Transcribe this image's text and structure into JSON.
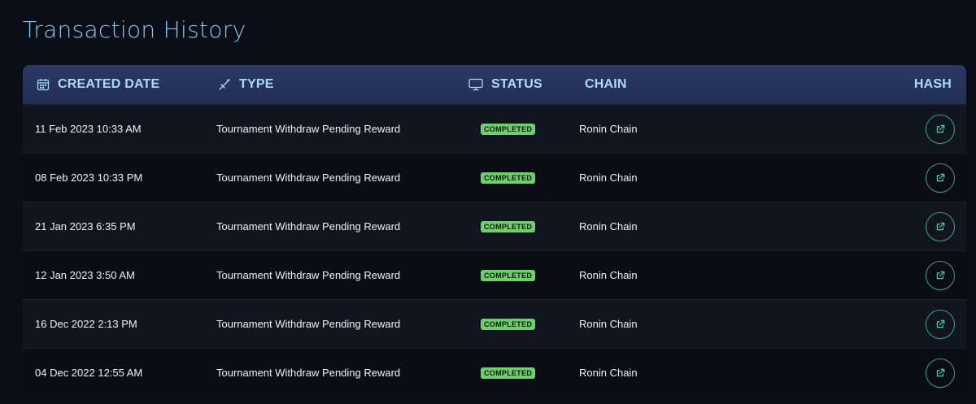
{
  "title": "Transaction History",
  "columns": {
    "date": "CREATED DATE",
    "type": "TYPE",
    "status": "STATUS",
    "chain": "CHAIN",
    "hash": "HASH"
  },
  "icons": {
    "date": "calendar-icon",
    "type": "sword-icon",
    "status": "monitor-icon",
    "hash": "external-link-icon"
  },
  "colors": {
    "title": "#7fc8ec",
    "header_text": "#a9dbf6",
    "header_bg": "#26335e",
    "badge_bg": "#6fcf6c",
    "link_border": "#3c9f8f"
  },
  "rows": [
    {
      "date": "11 Feb 2023 10:33 AM",
      "type": "Tournament Withdraw Pending Reward",
      "status": "COMPLETED",
      "chain": "Ronin Chain"
    },
    {
      "date": "08 Feb 2023 10:33 PM",
      "type": "Tournament Withdraw Pending Reward",
      "status": "COMPLETED",
      "chain": "Ronin Chain"
    },
    {
      "date": "21 Jan 2023 6:35 PM",
      "type": "Tournament Withdraw Pending Reward",
      "status": "COMPLETED",
      "chain": "Ronin Chain"
    },
    {
      "date": "12 Jan 2023 3:50 AM",
      "type": "Tournament Withdraw Pending Reward",
      "status": "COMPLETED",
      "chain": "Ronin Chain"
    },
    {
      "date": "16 Dec 2022 2:13 PM",
      "type": "Tournament Withdraw Pending Reward",
      "status": "COMPLETED",
      "chain": "Ronin Chain"
    },
    {
      "date": "04 Dec 2022 12:55 AM",
      "type": "Tournament Withdraw Pending Reward",
      "status": "COMPLETED",
      "chain": "Ronin Chain"
    }
  ]
}
